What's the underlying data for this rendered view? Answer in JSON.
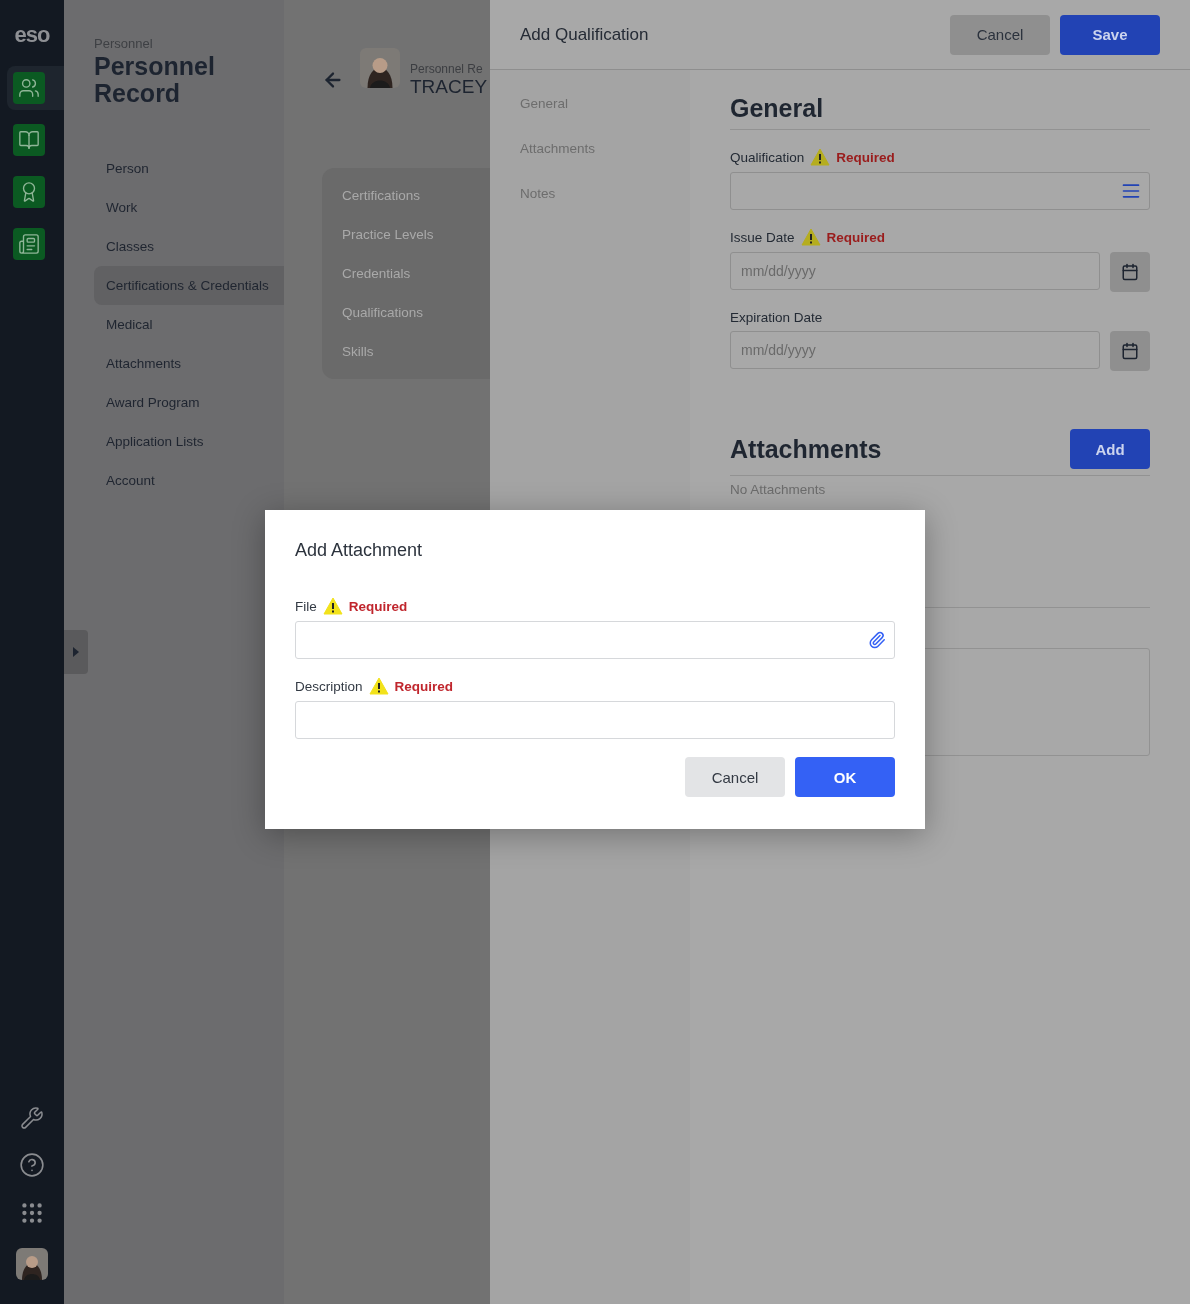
{
  "rail": {
    "logo": "eso",
    "apps": [
      {
        "kind": "people",
        "selected": true
      },
      {
        "kind": "book",
        "selected": false
      },
      {
        "kind": "award",
        "selected": false
      },
      {
        "kind": "news",
        "selected": false
      }
    ],
    "tools": [
      {
        "kind": "wrench"
      },
      {
        "kind": "help"
      },
      {
        "kind": "apps"
      },
      {
        "kind": "avatar"
      }
    ]
  },
  "nav": {
    "eyebrow": "Personnel",
    "title": "Personnel Record",
    "items": [
      {
        "label": "Person",
        "selected": false
      },
      {
        "label": "Work",
        "selected": false
      },
      {
        "label": "Classes",
        "selected": false
      },
      {
        "label": "Certifications & Credentials",
        "selected": true
      },
      {
        "label": "Medical",
        "selected": false
      },
      {
        "label": "Attachments",
        "selected": false
      },
      {
        "label": "Award Program",
        "selected": false
      },
      {
        "label": "Application Lists",
        "selected": false
      },
      {
        "label": "Account",
        "selected": false
      }
    ]
  },
  "record": {
    "eyebrow": "Personnel Re",
    "name": "TRACEY",
    "tabs": [
      "Certifications",
      "Practice Levels",
      "Credentials",
      "Qualifications",
      "Skills"
    ]
  },
  "drawer": {
    "title": "Add Qualification",
    "buttons": [
      {
        "label": "Cancel",
        "kind": "secondary"
      },
      {
        "label": "Save",
        "kind": "primary"
      }
    ],
    "sections": [
      "General",
      "Attachments",
      "Notes"
    ],
    "general": {
      "heading": "General",
      "fields": [
        {
          "label": "Qualification",
          "kind": "select",
          "required": true,
          "note": "Required"
        },
        {
          "label": "Issue Date",
          "kind": "date",
          "required": true,
          "note": "Required",
          "placeholder": "mm/dd/yyyy"
        },
        {
          "label": "Expiration Date",
          "kind": "date",
          "required": false,
          "placeholder": "mm/dd/yyyy"
        }
      ]
    },
    "attachments": {
      "heading": "Attachments",
      "add": "Add",
      "empty": "No Attachments"
    }
  },
  "dialog": {
    "title": "Add Attachment",
    "fields": [
      {
        "label": "File",
        "kind": "file",
        "required": true,
        "note": "Required"
      },
      {
        "label": "Description",
        "kind": "text",
        "required": true,
        "note": "Required"
      }
    ],
    "buttons": [
      {
        "label": "Cancel",
        "kind": "secondary"
      },
      {
        "label": "OK",
        "kind": "primary"
      }
    ]
  }
}
